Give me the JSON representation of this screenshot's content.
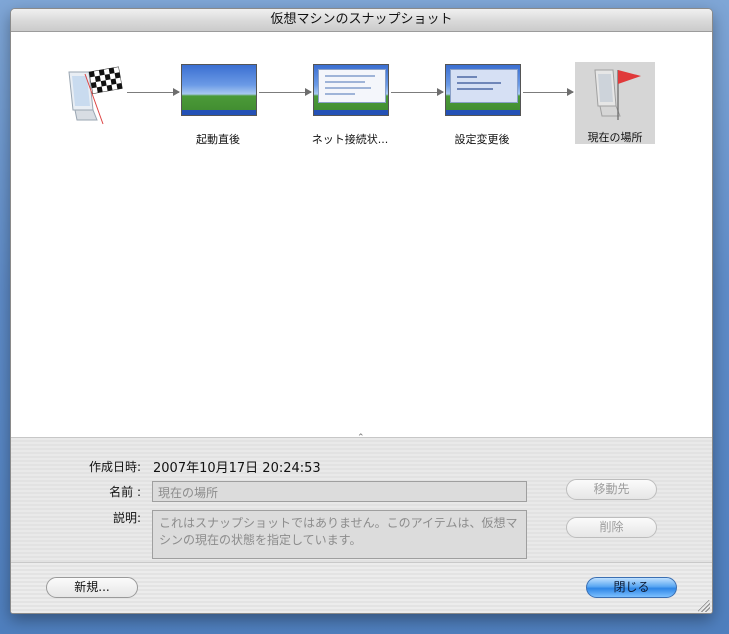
{
  "window": {
    "title": "仮想マシンのスナップショット"
  },
  "snapshots": [
    {
      "name": "",
      "icon": "start-flag-icon",
      "selected": false
    },
    {
      "name": "起動直後",
      "selected": false
    },
    {
      "name": "ネット接続状...",
      "selected": false
    },
    {
      "name": "設定変更後",
      "selected": false
    },
    {
      "name": "現在の場所",
      "icon": "current-location-flag-icon",
      "selected": true
    }
  ],
  "details": {
    "created_label": "作成日時:",
    "created_value": "2007年10月17日 20:24:53",
    "name_label": "名前 :",
    "name_value": "現在の場所",
    "description_label": "説明:",
    "description_value": "これはスナップショットではありません。このアイテムは、仮想マシンの現在の状態を指定しています。"
  },
  "buttons": {
    "move_to": "移動先",
    "delete": "削除",
    "new": "新規...",
    "close": "閉じる"
  },
  "colors": {
    "accent": "#2e86e6",
    "flag_red": "#e0393a"
  }
}
